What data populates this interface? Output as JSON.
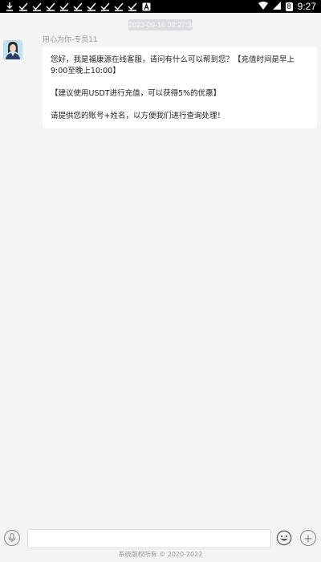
{
  "status_bar": {
    "time": "9:27",
    "battery_level": "8",
    "left_icons": [
      "download-icon",
      "check-icon",
      "check-icon",
      "check-icon",
      "check-icon",
      "check-icon",
      "check-icon",
      "check-icon",
      "check-icon",
      "check-icon",
      "a-notification-icon"
    ]
  },
  "chat": {
    "timestamp": "2023-09-16 09:27:30",
    "sender_name": "用心为你-专员11",
    "message": {
      "line1": "您好，我是福康源在线客服，请问有什么可以帮到您？【充值时间是早上9:00至晚上10:00】",
      "line2": "【建议使用USDT进行充值，可以获得5%的优惠】",
      "line3": "请提供您的账号+姓名，以方便我们进行查询处理！"
    }
  },
  "input_bar": {
    "placeholder": "",
    "value": ""
  },
  "footer": {
    "copyright": "系统版权所有 © 2020-2022"
  },
  "colors": {
    "background": "#f4f4f5",
    "bubble": "#ffffff",
    "status_bar": "#000000",
    "timestamp_badge": "#dcdcde"
  }
}
